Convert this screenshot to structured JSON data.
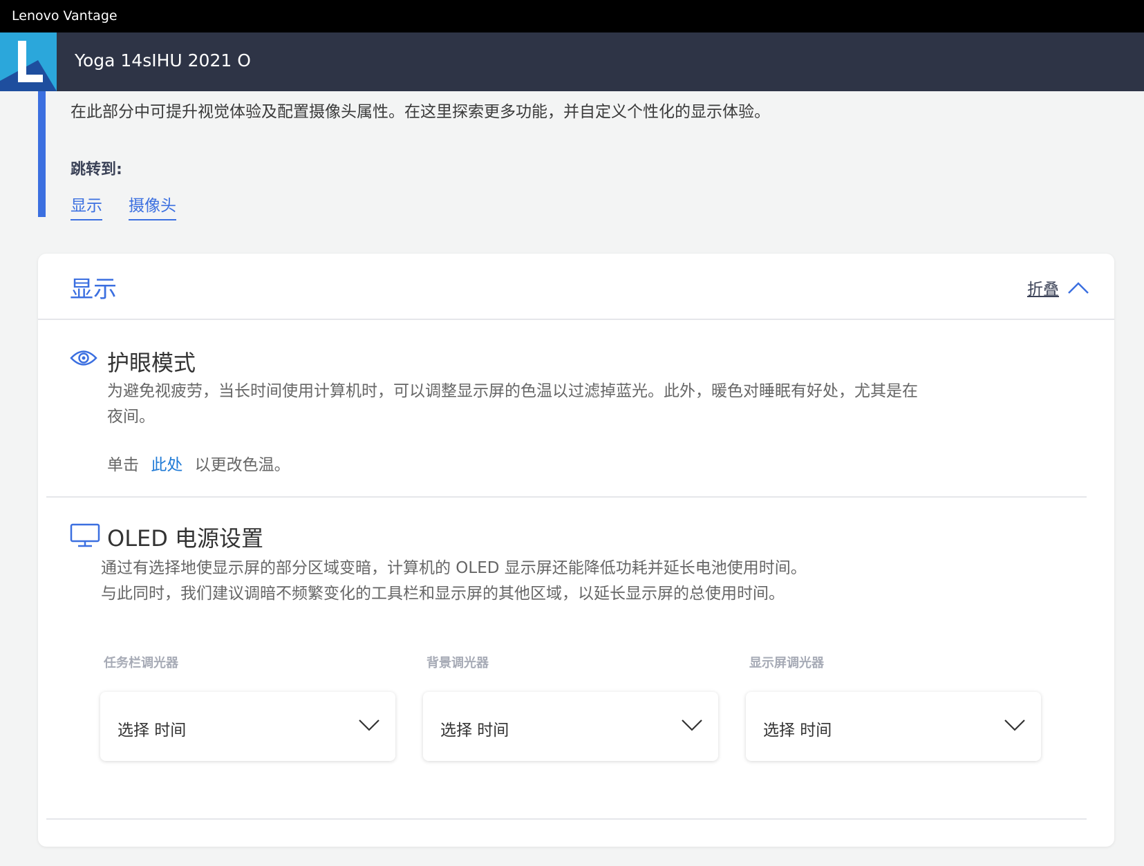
{
  "window": {
    "title": "Lenovo Vantage"
  },
  "header": {
    "logo_letter": "L",
    "device_name": "Yoga 14sIHU 2021 O"
  },
  "intro": {
    "description": "在此部分中可提升视觉体验及配置摄像头属性。在这里探索更多功能，并自定义个性化的显示体验。",
    "jump_label": "跳转到:",
    "jump_links": [
      "显示",
      "摄像头"
    ]
  },
  "display_section": {
    "title": "显示",
    "collapse_label": "折叠",
    "eye_care": {
      "title": "护眼模式",
      "desc_line1": "为避免视疲劳，当长时间使用计算机时，可以调整显示屏的色温以过滤掉蓝光。此外，暖色对睡眠有好处，尤其是在",
      "desc_line2": "夜间。",
      "click_prefix": "单击",
      "click_link": "此处",
      "click_suffix": "以更改色温。"
    },
    "oled": {
      "title": "OLED 电源设置",
      "desc_line1": "通过有选择地使显示屏的部分区域变暗，计算机的 OLED 显示屏还能降低功耗并延长电池使用时间。",
      "desc_line2": "与此同时，我们建议调暗不频繁变化的工具栏和显示屏的其他区域，以延长显示屏的总使用时间。",
      "dimmers": [
        {
          "label": "任务栏调光器",
          "value": "选择 时间"
        },
        {
          "label": "背景调光器",
          "value": "选择 时间"
        },
        {
          "label": "显示屏调光器",
          "value": "选择 时间"
        }
      ]
    }
  },
  "colors": {
    "accent": "#3b6fe0",
    "link": "#1f7ad6",
    "header_bg": "#2e3446",
    "logo_bg": "#2ba7db"
  },
  "icons": [
    "eye-icon",
    "monitor-icon",
    "chevron-up-icon",
    "chevron-down-icon"
  ]
}
